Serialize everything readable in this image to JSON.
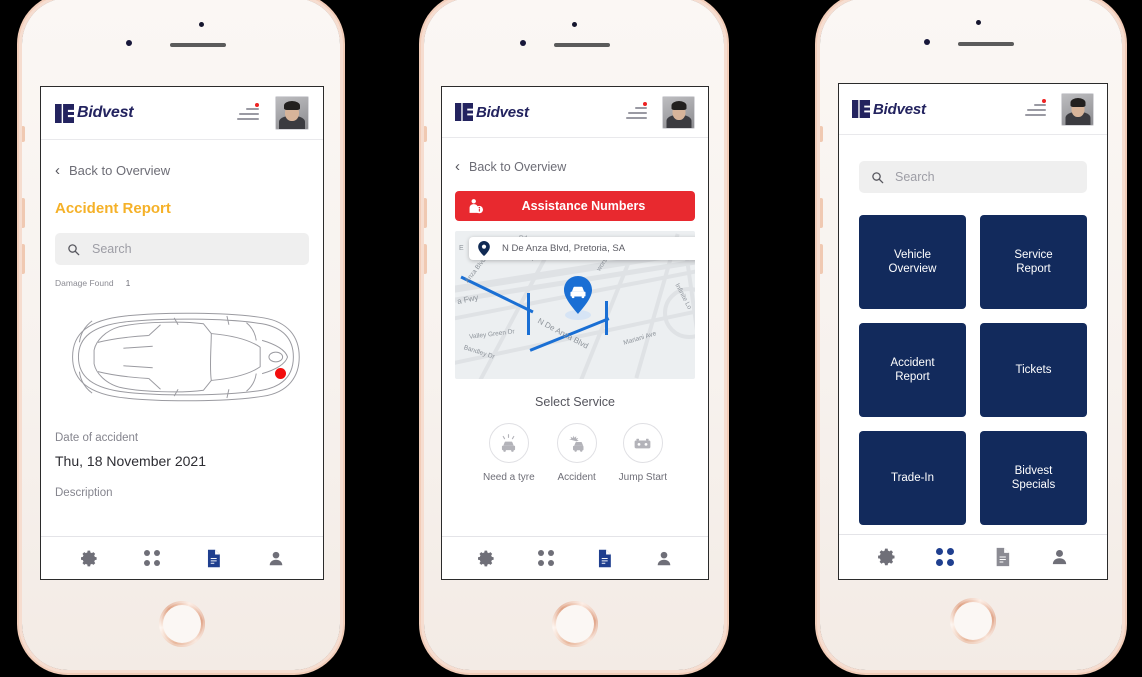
{
  "brand": {
    "name": "Bidvest",
    "logo_color": "#23235f",
    "accent_red": "#e8292f",
    "accent_navy": "#122a5c",
    "accent_yellow": "#f5b128"
  },
  "header": {
    "logo_text": "Bidvest",
    "menu_icon": "hamburger-menu-icon",
    "notification_dot_color": "#ee2222",
    "avatar_icon": "user-avatar"
  },
  "tabbar": {
    "items": [
      {
        "icon": "gear-icon",
        "name": "settings"
      },
      {
        "icon": "grid-dots-icon",
        "name": "dashboard"
      },
      {
        "icon": "document-icon",
        "name": "reports"
      },
      {
        "icon": "person-icon",
        "name": "profile"
      }
    ],
    "active_color": "#1f3f8f",
    "inactive_color": "#808089"
  },
  "phone1": {
    "back_label": "Back to Overview",
    "back_icon": "chevron-left-icon",
    "title": "Accident Report",
    "search": {
      "placeholder": "Search",
      "icon": "search-icon",
      "value": ""
    },
    "damage_label": "Damage Found",
    "damage_count": "1",
    "car_diagram": "car-top-view-outline",
    "damage_marker_color": "#f20d0d",
    "date_label": "Date  of accident",
    "date_value": "Thu, 18 November 2021",
    "description_label": "Description",
    "active_tab": 2
  },
  "phone2": {
    "back_label": "Back to Overview",
    "back_icon": "chevron-left-icon",
    "assistance_button": {
      "label": "Assistance Numbers",
      "icon": "person-info-icon",
      "color": "#e8292f"
    },
    "map": {
      "address": "N De Anza Blvd, Pretoria, SA",
      "address_icon": "map-pin-icon",
      "vehicle_icon": "car-pin-icon",
      "route_color": "#1a6fd4",
      "street_labels": [
        "Via Palamos",
        "Anza Blvd",
        "a Fwy",
        "N De Anza Blvd",
        "Valley Green Dr",
        "Bandley Dr",
        "Mariani Ave",
        "Infinite Lo",
        "worst Dr",
        "E",
        "Rd",
        "Dr"
      ]
    },
    "select_service_label": "Select Service",
    "services": [
      {
        "label": "Need a tyre",
        "icon": "tyre-car-icon"
      },
      {
        "label": "Accident",
        "icon": "crash-car-icon"
      },
      {
        "label": "Jump Start",
        "icon": "battery-icon"
      }
    ],
    "active_tab": 2
  },
  "phone3": {
    "search": {
      "placeholder": "Search",
      "icon": "search-icon",
      "value": ""
    },
    "tiles": [
      {
        "line1": "Vehicle",
        "line2": "Overview"
      },
      {
        "line1": "Service",
        "line2": "Report"
      },
      {
        "line1": "Accident",
        "line2": "Report"
      },
      {
        "line1": "Tickets",
        "line2": ""
      },
      {
        "line1": "Trade-In",
        "line2": ""
      },
      {
        "line1": "Bidvest",
        "line2": "Specials"
      }
    ],
    "active_tab": 1
  }
}
